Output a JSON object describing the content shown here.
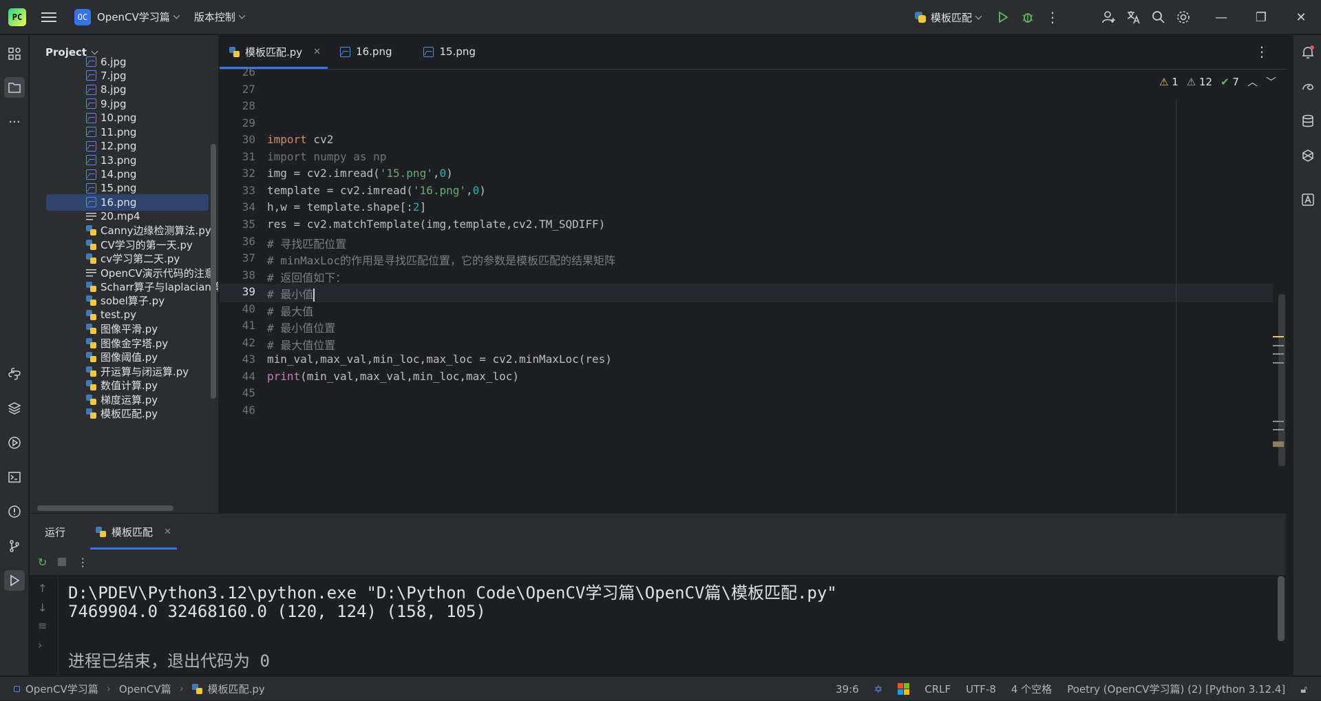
{
  "titlebar": {
    "project_badge": "OC",
    "project_name": "OpenCV学习篇",
    "vcs_label": "版本控制",
    "run_config": "模板匹配"
  },
  "project_panel": {
    "title": "Project",
    "items": [
      {
        "name": "6.jpg",
        "type": "image"
      },
      {
        "name": "7.jpg",
        "type": "image"
      },
      {
        "name": "8.jpg",
        "type": "image"
      },
      {
        "name": "9.jpg",
        "type": "image"
      },
      {
        "name": "10.png",
        "type": "image"
      },
      {
        "name": "11.png",
        "type": "image"
      },
      {
        "name": "12.png",
        "type": "image"
      },
      {
        "name": "13.png",
        "type": "image"
      },
      {
        "name": "14.png",
        "type": "image"
      },
      {
        "name": "15.png",
        "type": "image"
      },
      {
        "name": "16.png",
        "type": "image",
        "selected": true
      },
      {
        "name": "20.mp4",
        "type": "text"
      },
      {
        "name": "Canny边缘检测算法.py",
        "type": "python"
      },
      {
        "name": "CV学习的第一天.py",
        "type": "python"
      },
      {
        "name": "cv学习第二天.py",
        "type": "python"
      },
      {
        "name": "OpenCV演示代码的注意",
        "type": "text"
      },
      {
        "name": "Scharr算子与laplacian算",
        "type": "python"
      },
      {
        "name": "sobel算子.py",
        "type": "python"
      },
      {
        "name": "test.py",
        "type": "python"
      },
      {
        "name": "图像平滑.py",
        "type": "python"
      },
      {
        "name": "图像金字塔.py",
        "type": "python"
      },
      {
        "name": "图像阈值.py",
        "type": "python"
      },
      {
        "name": "开运算与闭运算.py",
        "type": "python"
      },
      {
        "name": "数值计算.py",
        "type": "python"
      },
      {
        "name": "梯度运算.py",
        "type": "python"
      },
      {
        "name": "模板匹配.py",
        "type": "python"
      }
    ]
  },
  "editor": {
    "tabs": [
      {
        "label": "模板匹配.py",
        "type": "python",
        "active": true
      },
      {
        "label": "16.png",
        "type": "image"
      },
      {
        "label": "15.png",
        "type": "image"
      }
    ],
    "inspections": {
      "warnings": "1",
      "weak_warnings": "12",
      "ok": "7"
    },
    "line_numbers": [
      "26",
      "27",
      "28",
      "29",
      "30",
      "31",
      "32",
      "33",
      "34",
      "35",
      "36",
      "37",
      "38",
      "39",
      "40",
      "41",
      "42",
      "43",
      "44",
      "45",
      "46"
    ],
    "current_line": "39"
  },
  "run_panel": {
    "label": "运行",
    "tab": "模板匹配",
    "console": [
      "D:\\PDEV\\Python3.12\\python.exe \"D:\\Python Code\\OpenCV学习篇\\OpenCV篇\\模板匹配.py\"",
      "7469904.0 32468160.0 (120, 124) (158, 105)",
      "",
      "进程已结束，退出代码为 0"
    ]
  },
  "statusbar": {
    "breadcrumb": [
      "OpenCV学习篇",
      "OpenCV篇",
      "模板匹配.py"
    ],
    "position": "39:6",
    "line_ending": "CRLF",
    "encoding": "UTF-8",
    "indent": "4 个空格",
    "interpreter": "Poetry (OpenCV学习篇) (2) [Python 3.12.4]"
  },
  "colors": {
    "accent": "#3574f0",
    "background": "#1e1f22",
    "panel": "#2b2d30",
    "keyword": "#cf8e6d",
    "string": "#6aab73",
    "number": "#2aacb8",
    "comment": "#7a7e85"
  },
  "icons": [
    "pycharm-logo",
    "hamburger-menu",
    "run-icon",
    "debug-icon",
    "more-icon",
    "add-user-icon",
    "translate-icon",
    "search-icon",
    "gear-icon",
    "minimize-icon",
    "restore-icon",
    "close-icon",
    "structure-icon",
    "folder-icon",
    "python-console-icon",
    "layers-icon",
    "services-icon",
    "terminal-icon",
    "problems-icon",
    "git-icon",
    "run-panel-icon",
    "bell-icon",
    "ai-assistant-icon",
    "database-icon",
    "plugin-icon",
    "font-icon"
  ]
}
